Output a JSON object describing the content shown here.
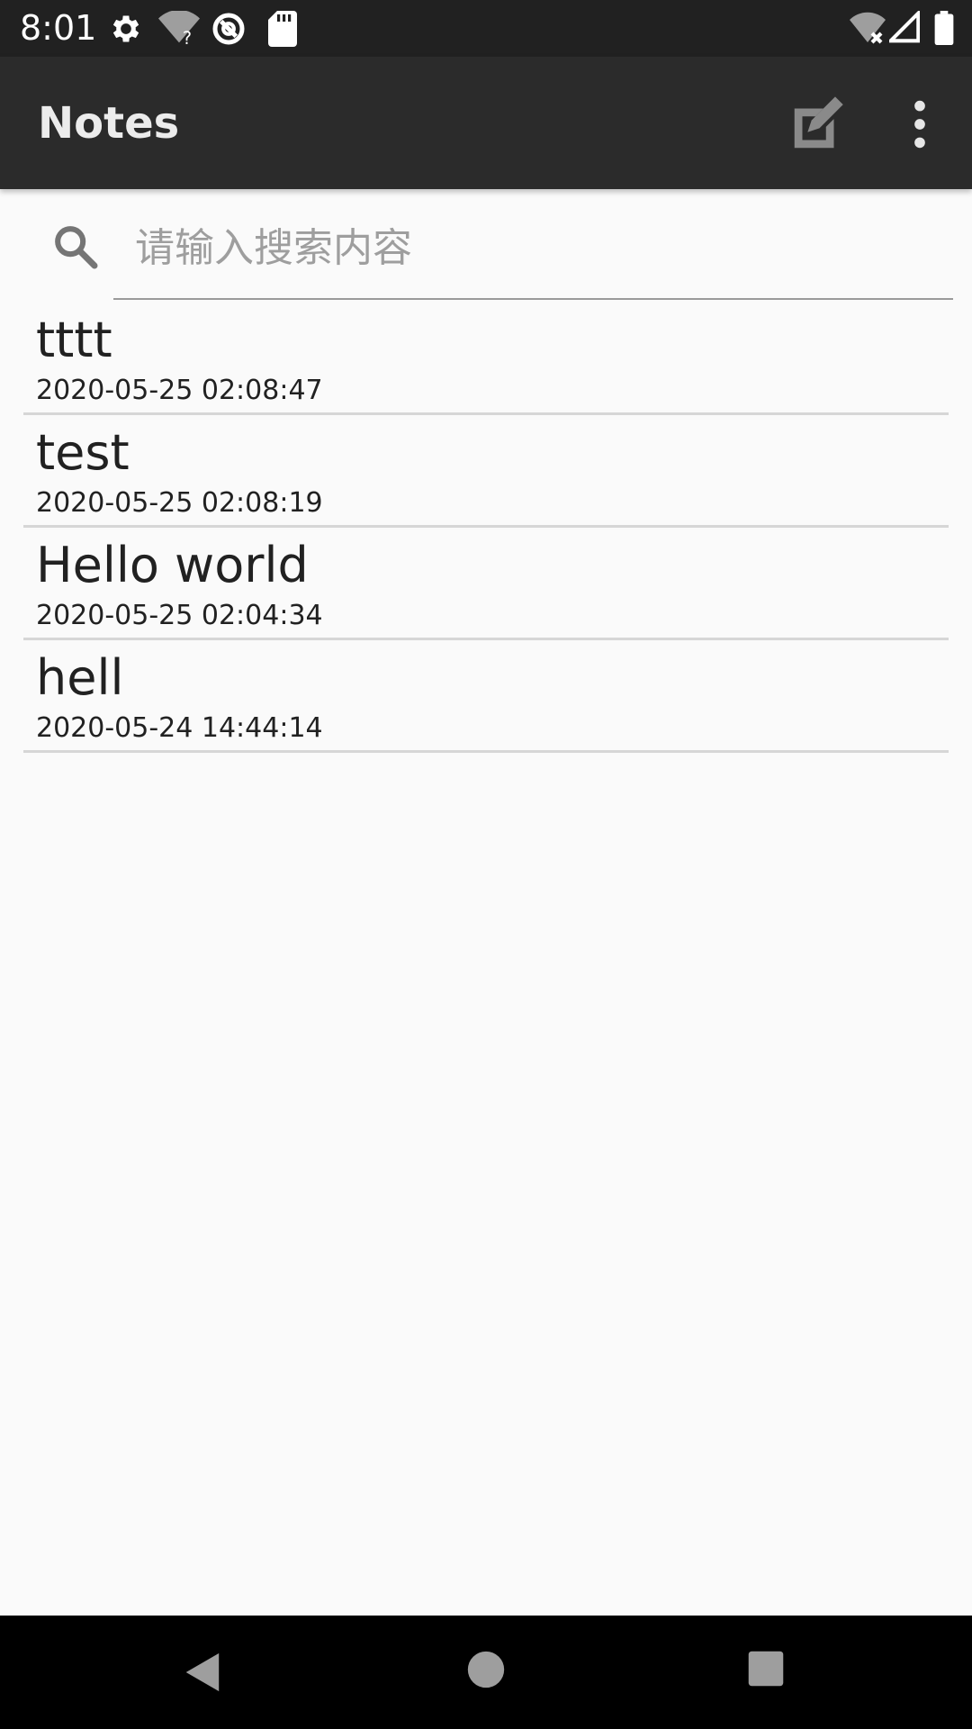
{
  "status_bar": {
    "time": "8:01",
    "icons": [
      "settings-icon",
      "wifi-unknown-icon",
      "vpn-icon",
      "sd-card-icon",
      "wifi-off-icon",
      "signal-icon",
      "battery-icon"
    ]
  },
  "app_bar": {
    "title": "Notes",
    "actions": [
      "edit-note-icon",
      "more-vert-icon"
    ]
  },
  "search": {
    "placeholder": "请输入搜索内容",
    "value": ""
  },
  "notes": [
    {
      "title": "tttt",
      "time": "2020-05-25 02:08:47"
    },
    {
      "title": "test",
      "time": "2020-05-25 02:08:19"
    },
    {
      "title": "Hello world",
      "time": "2020-05-25 02:04:34"
    },
    {
      "title": "hell",
      "time": "2020-05-24 14:44:14"
    }
  ],
  "nav_bar": {
    "buttons": [
      "back-icon",
      "home-icon",
      "recents-icon"
    ]
  },
  "colors": {
    "status_bar": "#212121",
    "app_bar": "#2b2b2b",
    "background": "#fafafa",
    "divider": "#d6d6d6",
    "nav_bar": "#000000"
  }
}
